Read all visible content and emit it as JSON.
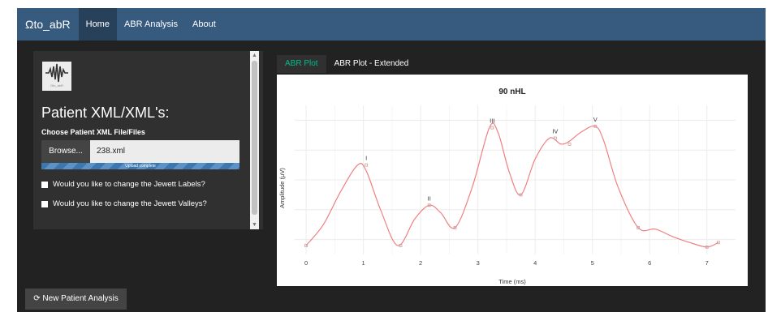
{
  "navbar": {
    "brand": "Ωto_abR",
    "items": [
      {
        "label": "Home"
      },
      {
        "label": "ABR Analysis"
      },
      {
        "label": "About"
      }
    ]
  },
  "sidebar": {
    "title": "Patient XML/XML's:",
    "choose_label": "Choose Patient XML File/Files",
    "browse_label": "Browse...",
    "file_value": "238.xml",
    "progress_text": "Upload complete",
    "progress": 1.0,
    "checkbox_labels_1": "Would you like to change the Jewett Labels?",
    "checkbox_labels_2": "Would you like to change the Jewett Valleys?",
    "logo_caption": "Oto_abR"
  },
  "tabs": [
    {
      "label": "ABR Plot",
      "active": true
    },
    {
      "label": "ABR Plot - Extended",
      "active": false
    }
  ],
  "footer": {
    "new_analysis_label": "New Patient Analysis"
  },
  "colors": {
    "accent": "#00bc8c",
    "navbar": "#375a7f",
    "trace": "#f08080"
  },
  "chart_data": {
    "type": "line",
    "title": "90 nHL",
    "xlabel": "Time (ms)",
    "ylabel": "Amplitude (μV)",
    "xlim": [
      -0.2,
      7.5
    ],
    "ylim": [
      0,
      1
    ],
    "xticks": [
      0,
      1,
      2,
      3,
      4,
      5,
      6,
      7
    ],
    "grid": true,
    "x": [
      0,
      0.3,
      0.6,
      0.9,
      1.05,
      1.3,
      1.6,
      1.9,
      2.15,
      2.35,
      2.6,
      2.9,
      3.2,
      3.35,
      3.55,
      3.75,
      4.0,
      4.25,
      4.45,
      4.6,
      4.8,
      5.05,
      5.2,
      5.45,
      5.8,
      6.1,
      6.4,
      6.7,
      7.0,
      7.2
    ],
    "y": [
      0.06,
      0.2,
      0.42,
      0.6,
      0.56,
      0.3,
      0.06,
      0.24,
      0.33,
      0.28,
      0.18,
      0.45,
      0.85,
      0.82,
      0.55,
      0.4,
      0.64,
      0.78,
      0.74,
      0.76,
      0.82,
      0.86,
      0.76,
      0.45,
      0.18,
      0.17,
      0.12,
      0.08,
      0.05,
      0.08
    ],
    "peaks": [
      {
        "label": "I",
        "x": 1.05,
        "y": 0.6
      },
      {
        "label": "II",
        "x": 2.15,
        "y": 0.33
      },
      {
        "label": "III",
        "x": 3.25,
        "y": 0.85
      },
      {
        "label": "IV",
        "x": 4.35,
        "y": 0.78
      },
      {
        "label": "V",
        "x": 5.05,
        "y": 0.86
      }
    ],
    "valleys": [
      {
        "x": 0.0,
        "y": 0.06
      },
      {
        "x": 1.65,
        "y": 0.06
      },
      {
        "x": 2.6,
        "y": 0.18
      },
      {
        "x": 3.75,
        "y": 0.4
      },
      {
        "x": 4.6,
        "y": 0.74
      },
      {
        "x": 5.8,
        "y": 0.18
      },
      {
        "x": 7.0,
        "y": 0.05
      },
      {
        "x": 7.2,
        "y": 0.08
      }
    ]
  }
}
